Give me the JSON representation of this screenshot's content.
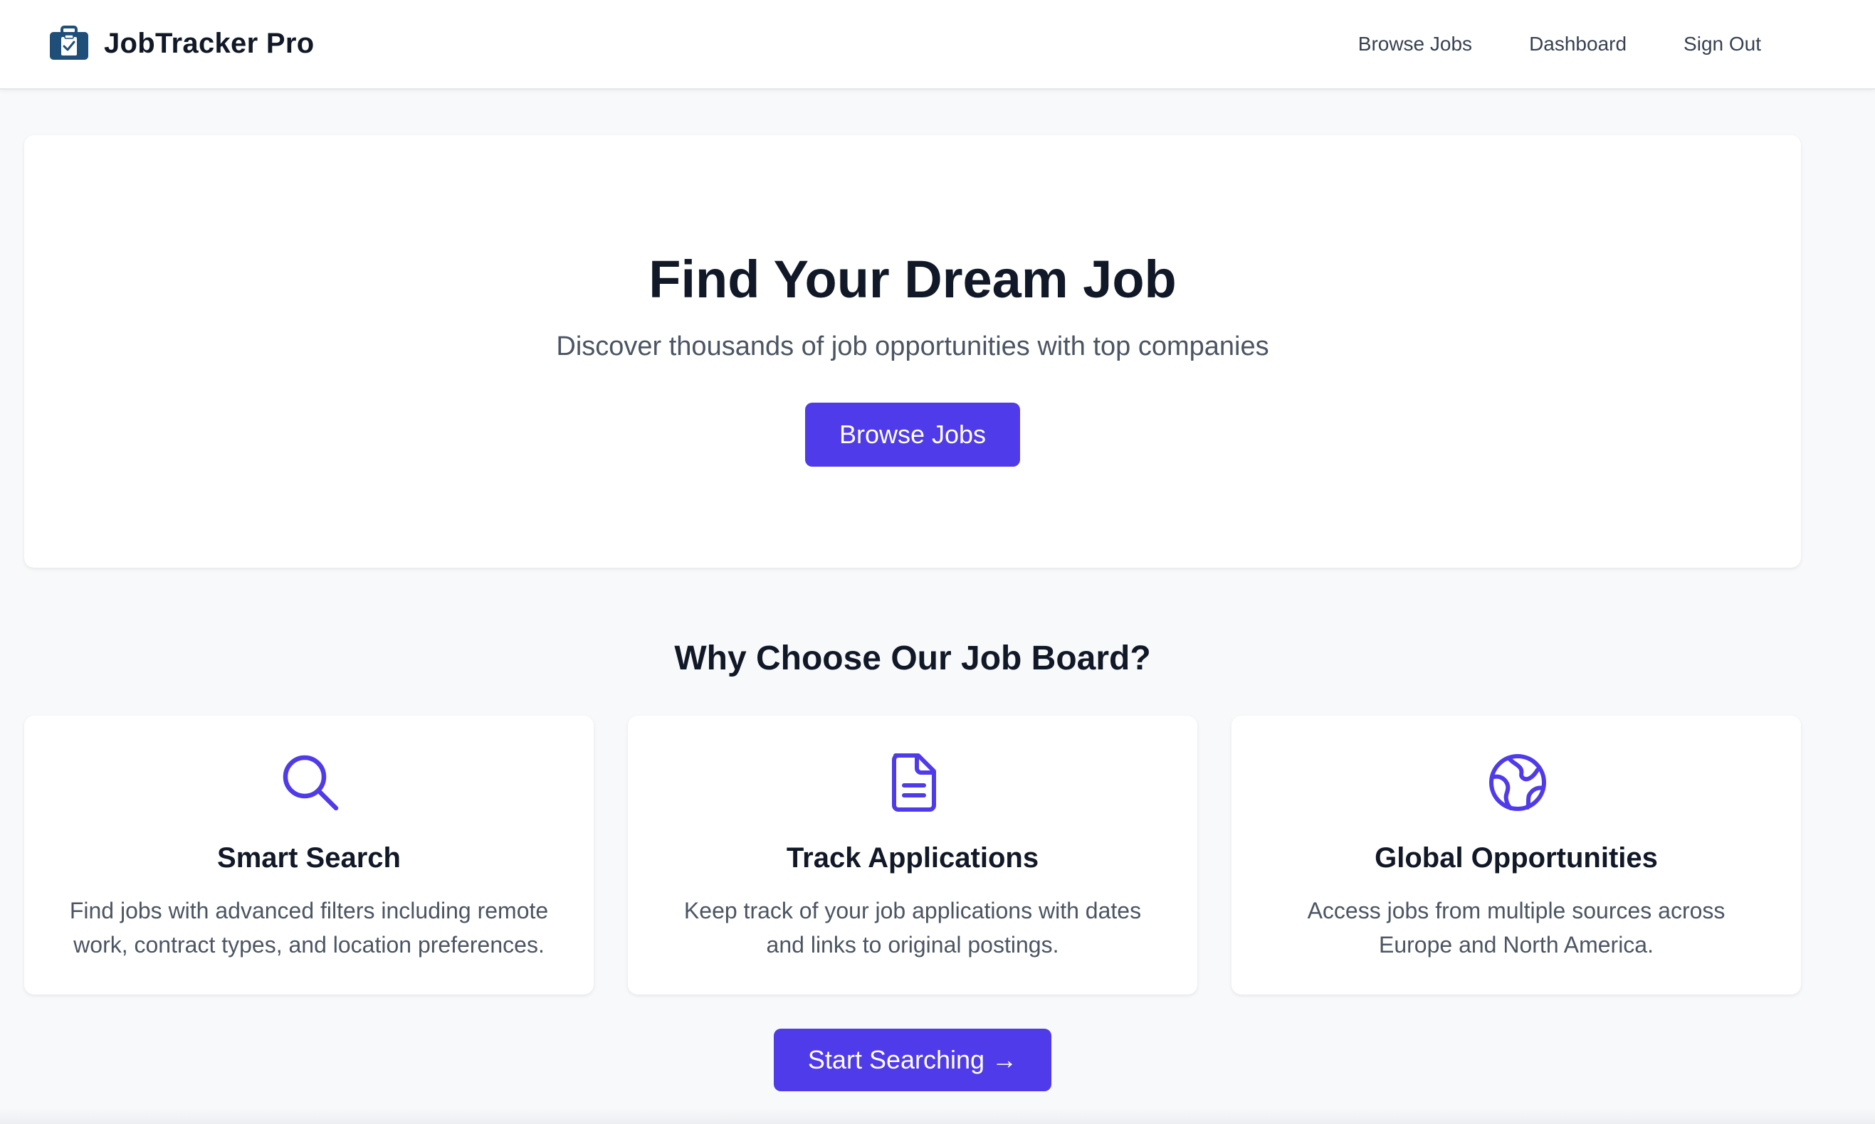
{
  "brand": {
    "name": "JobTracker Pro",
    "icon": "briefcase-check-icon",
    "color": "#1f4e79"
  },
  "nav": {
    "browse_jobs": "Browse Jobs",
    "dashboard": "Dashboard",
    "sign_out": "Sign Out"
  },
  "hero": {
    "title": "Find Your Dream Job",
    "subtitle": "Discover thousands of job opportunities with top companies",
    "button_label": "Browse Jobs"
  },
  "features": {
    "title": "Why Choose Our Job Board?",
    "items": [
      {
        "icon": "search-icon",
        "title": "Smart Search",
        "description": "Find jobs with advanced filters including remote work, contract types, and location preferences."
      },
      {
        "icon": "document-icon",
        "title": "Track Applications",
        "description": "Keep track of your job applications with dates and links to original postings."
      },
      {
        "icon": "globe-icon",
        "title": "Global Opportunities",
        "description": "Access jobs from multiple sources across Europe and North America."
      }
    ]
  },
  "cta": {
    "label": "Start Searching →"
  },
  "colors": {
    "accent": "#4f3be9",
    "background": "#f8f9fb",
    "text": "#111827",
    "muted": "#4b5563"
  }
}
